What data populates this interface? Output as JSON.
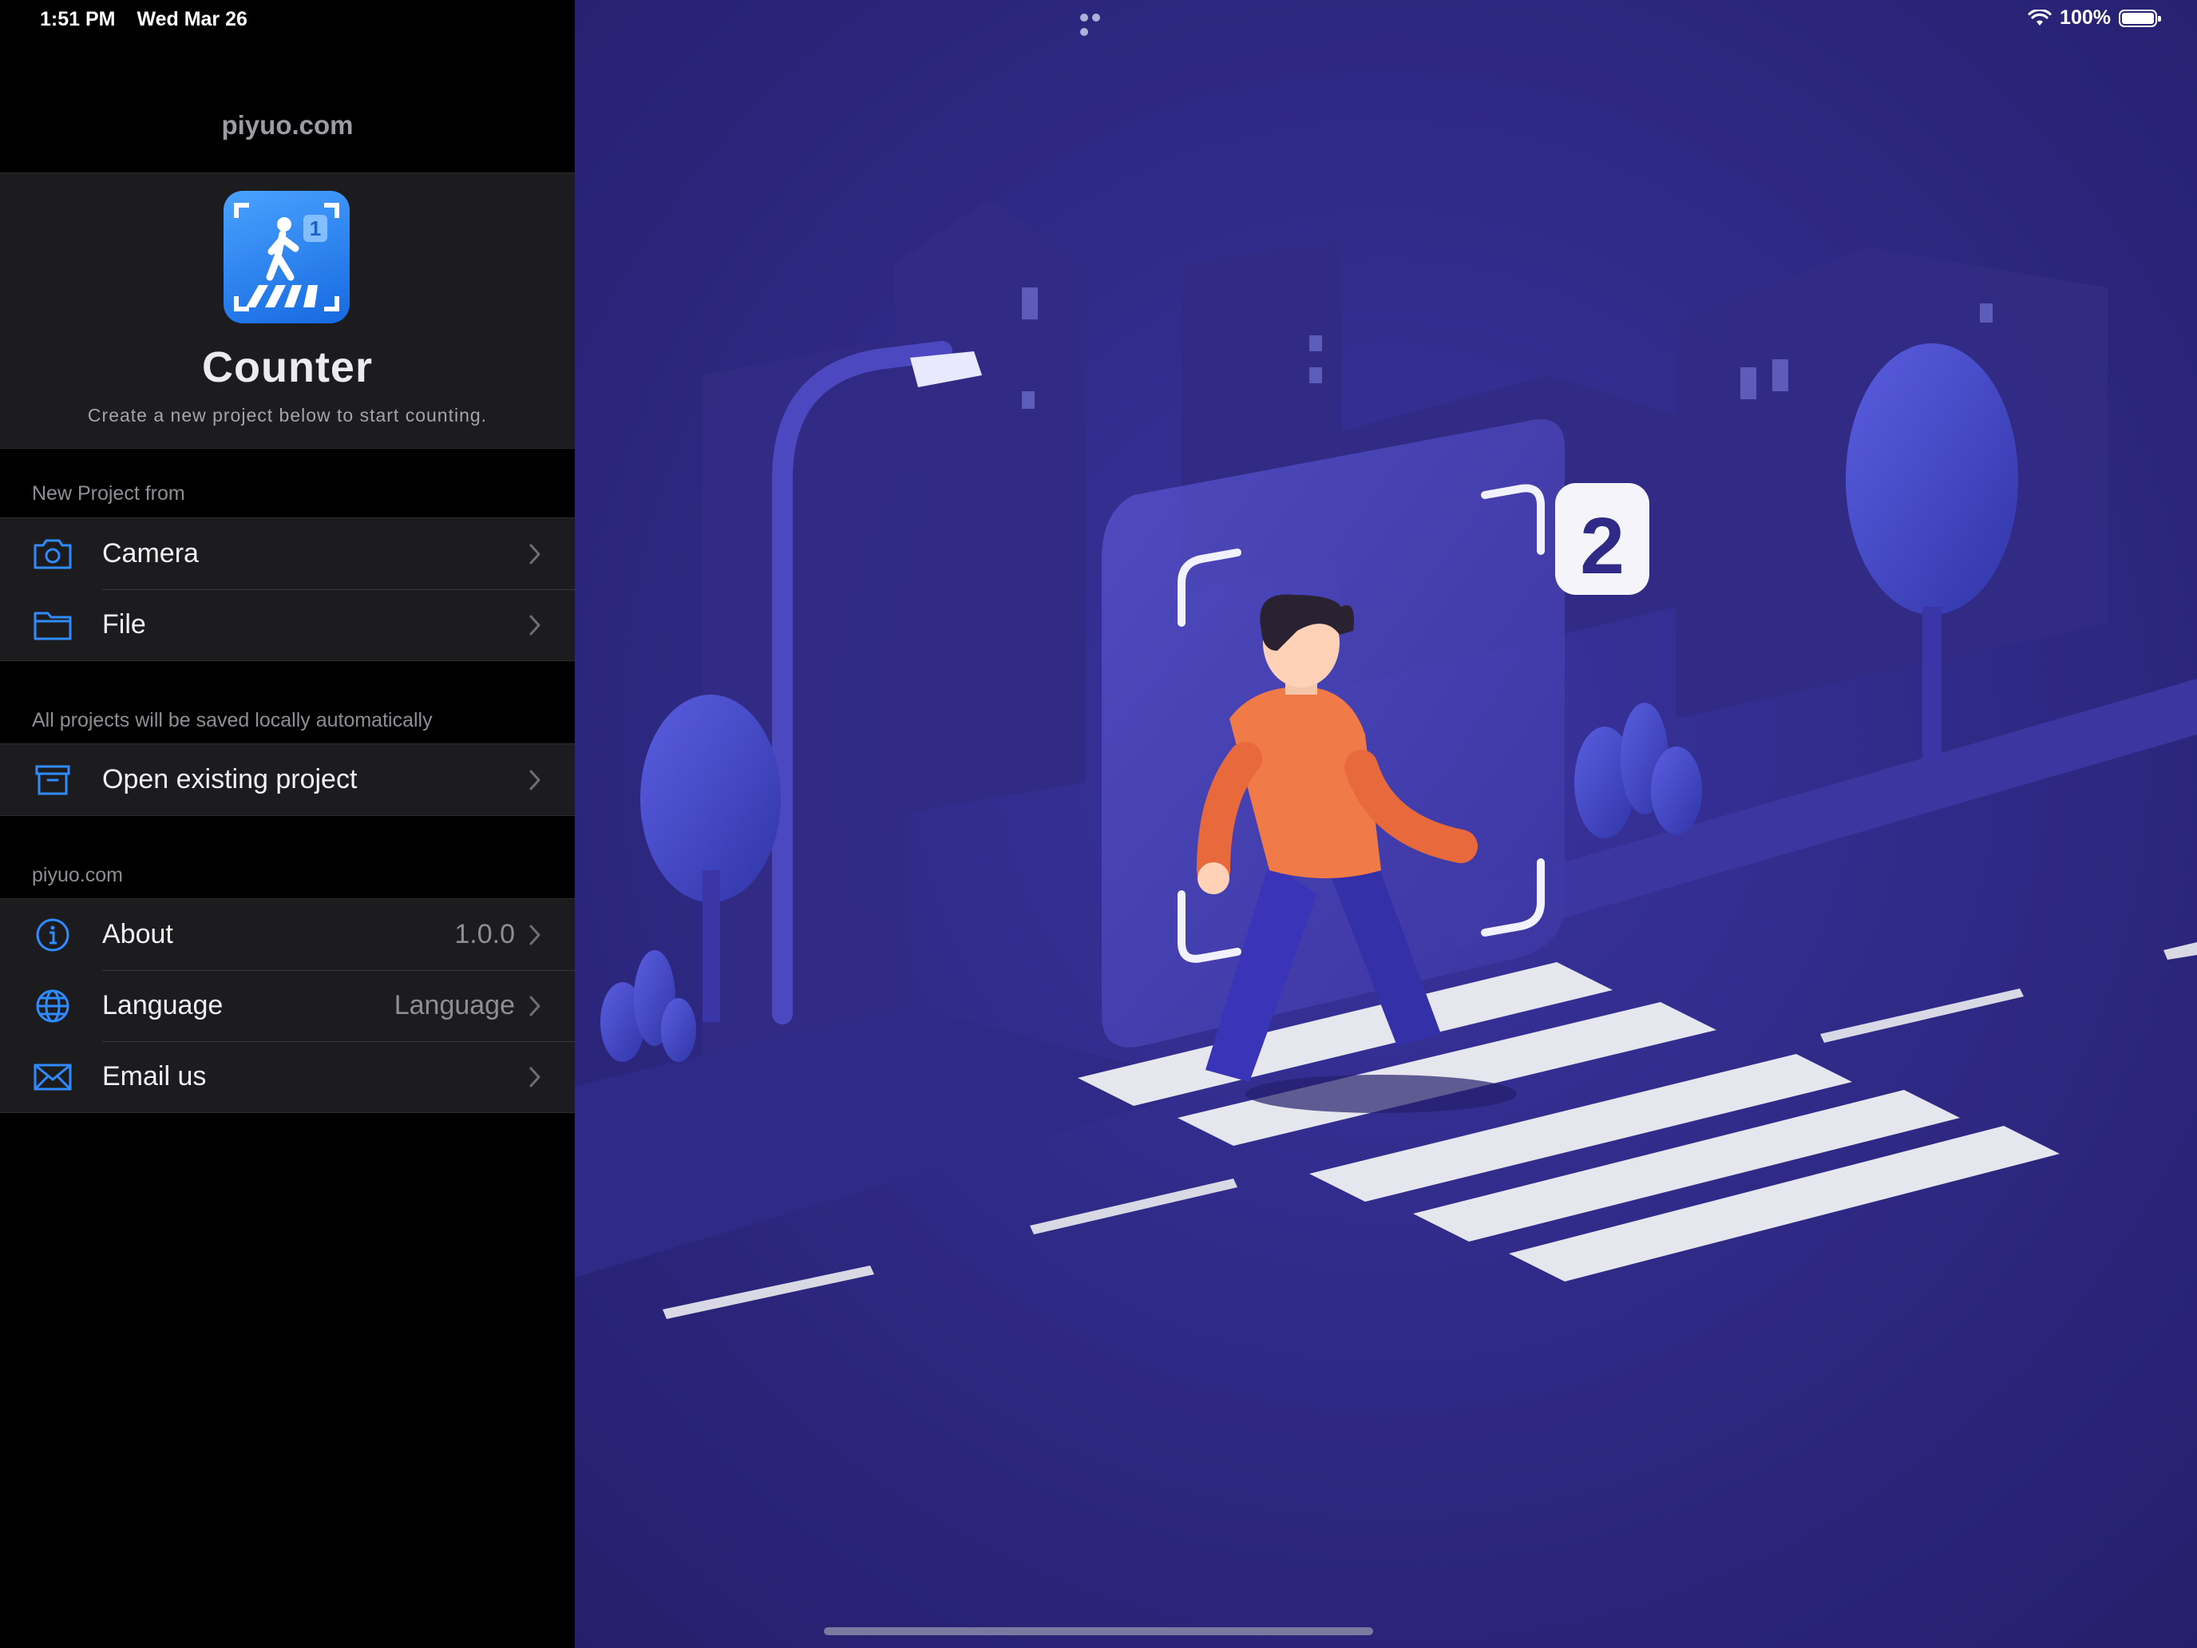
{
  "status_bar": {
    "time": "1:51 PM",
    "date": "Wed Mar 26",
    "battery": "100%"
  },
  "sidebar": {
    "site_title": "piyuo.com",
    "app": {
      "name": "Counter",
      "tagline": "Create a new project below to start counting.",
      "icon_badge": "1"
    },
    "new_project": {
      "label": "New Project from",
      "items": [
        {
          "label": "Camera",
          "icon": "camera-icon"
        },
        {
          "label": "File",
          "icon": "folder-icon"
        }
      ]
    },
    "existing": {
      "label": "All projects will be saved locally automatically",
      "items": [
        {
          "label": "Open existing project",
          "icon": "archive-icon"
        }
      ]
    },
    "info": {
      "label": "piyuo.com",
      "items": [
        {
          "label": "About",
          "value": "1.0.0",
          "icon": "info-icon"
        },
        {
          "label": "Language",
          "value": "Language",
          "icon": "globe-icon"
        },
        {
          "label": "Email us",
          "icon": "envelope-icon"
        }
      ]
    }
  },
  "illustration": {
    "count_badge": "2"
  },
  "colors": {
    "accent": "#2f8bff",
    "illustration_bg": "#2f2a84",
    "cell_bg": "#1c1c1e"
  }
}
